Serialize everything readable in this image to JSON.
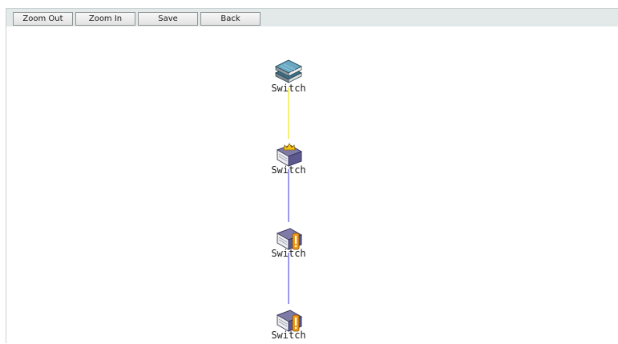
{
  "toolbar": {
    "zoom_out_label": "Zoom Out",
    "zoom_in_label": "Zoom In",
    "save_label": "Save",
    "back_label": "Back"
  },
  "topology": {
    "nodes": [
      {
        "label": "Switch",
        "icon": "switch-stack-icon"
      },
      {
        "label": "Switch",
        "icon": "switch-master-crown-icon"
      },
      {
        "label": "Switch",
        "icon": "switch-warning-icon"
      },
      {
        "label": "Switch",
        "icon": "switch-warning-icon"
      }
    ],
    "links": [
      {
        "from": 0,
        "to": 1,
        "color": "#f2e94a"
      },
      {
        "from": 1,
        "to": 2,
        "color": "#7b78e8"
      },
      {
        "from": 2,
        "to": 3,
        "color": "#7b78e8"
      }
    ]
  }
}
